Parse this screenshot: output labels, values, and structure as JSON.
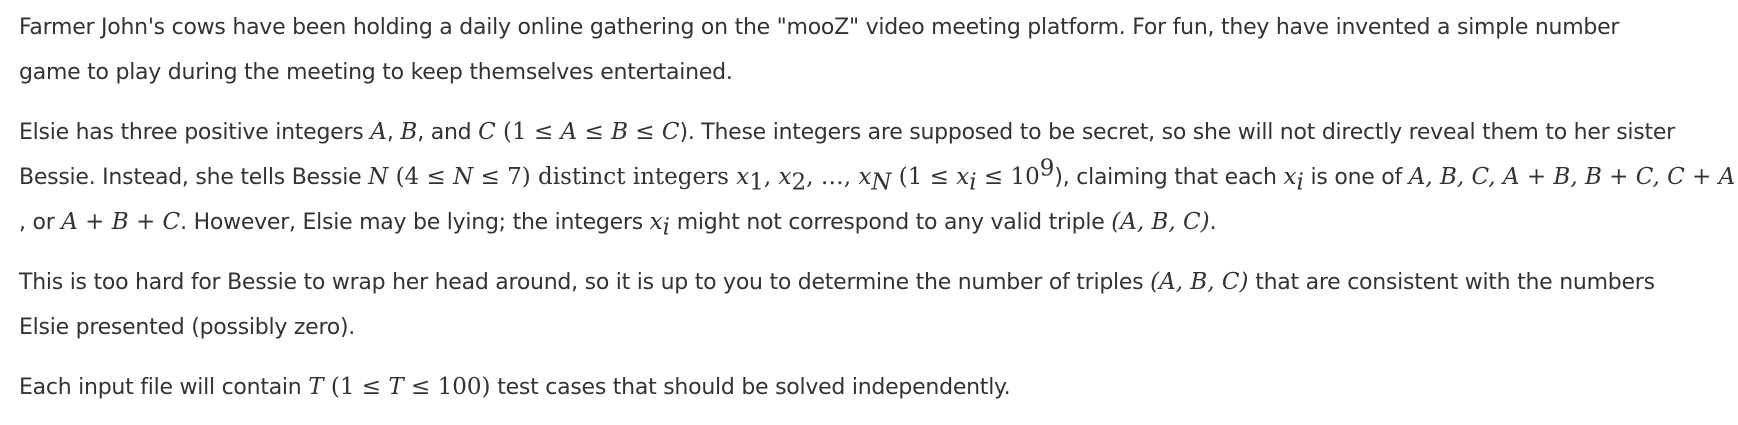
{
  "problem": {
    "p1": {
      "l1": "Farmer John's cows have been holding a daily online gathering on the \"mooZ\" video meeting platform. For fun, they have invented a simple number",
      "l2": "game to play during the meeting to keep themselves entertained."
    },
    "p2": {
      "a": "Elsie has three positive integers ",
      "A": "A",
      "sep1": ", ",
      "B": "B",
      "b": ", and ",
      "C": "C",
      "c": " (1 ≤ ",
      "d": "A",
      "e": " ≤ ",
      "f": "B",
      "g": " ≤ ",
      "h": "C",
      "i": "). These integers are supposed to be secret, so she will not directly reveal them to her sister",
      "j": "Bessie. Instead, she tells Bessie ",
      "N": "N",
      "k": " (4 ≤ ",
      "N2": "N",
      "l": " ≤ 7) distinct integers ",
      "x1": "x",
      "x1sub": "1",
      "m": ", ",
      "x2": "x",
      "x2sub": "2",
      "n": ", …, ",
      "xN": "x",
      "xNsub": "N",
      "o": " (1 ≤ ",
      "xi": "x",
      "xisub": "i",
      "p": " ≤ 10",
      "psup": "9",
      "q": "), claiming that each ",
      "xi2": "x",
      "xi2sub": "i",
      "r": " is one of ",
      "s": "A, B, C, A + B, B + C, C + A",
      "t": ", or ",
      "u": "A + B + C",
      "v": ". However, Elsie may be lying; the integers ",
      "xi3": "x",
      "xi3sub": "i",
      "w": " might not correspond to any valid triple ",
      "y": "(A, B, C)",
      "z": "."
    },
    "p3": {
      "a": "This is too hard for Bessie to wrap her head around, so it is up to you to determine the number of triples ",
      "b": "(A, B, C)",
      "c": " that are consistent with the numbers",
      "d": "Elsie presented (possibly zero)."
    },
    "p4": {
      "a": "Each input file will contain ",
      "T": "T",
      "b": " (1 ≤ ",
      "T2": "T",
      "c": " ≤ 100)",
      "d": " test cases that should be solved independently."
    }
  }
}
